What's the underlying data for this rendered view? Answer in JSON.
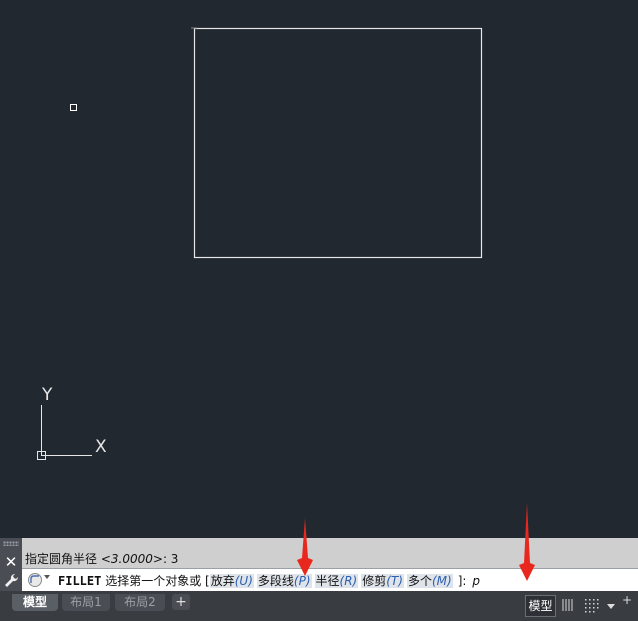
{
  "ucs": {
    "y_label": "Y",
    "x_label": "X"
  },
  "command_history": {
    "prefix": "指定圆角半径",
    "value_hint": "<3.0000>",
    "suffix": ": 3"
  },
  "command_line": {
    "command": "FILLET",
    "prompt": "选择第一个对象或",
    "open_bracket": "[",
    "options": [
      {
        "label": "放弃",
        "key": "(U)"
      },
      {
        "label": "多段线",
        "key": "(P)"
      },
      {
        "label": "半径",
        "key": "(R)"
      },
      {
        "label": "修剪",
        "key": "(T)"
      },
      {
        "label": "多个",
        "key": "(M)"
      }
    ],
    "close_bracket": "]:",
    "typed": "p"
  },
  "tabs": [
    {
      "label": "模型",
      "active": true
    },
    {
      "label": "布局1",
      "active": false
    },
    {
      "label": "布局2",
      "active": false
    }
  ],
  "tab_add": "+",
  "status": {
    "space_label": "模型",
    "more_label": "+"
  },
  "colors": {
    "canvas": "#212830",
    "annotation_arrow": "#e8281e",
    "option_key": "#2b5fb0"
  }
}
